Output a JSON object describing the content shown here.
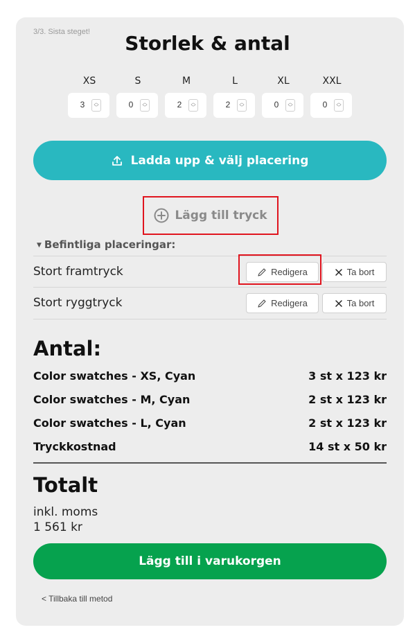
{
  "step": "3/3. Sista steget!",
  "title": "Storlek & antal",
  "sizes": [
    {
      "label": "XS",
      "value": "3"
    },
    {
      "label": "S",
      "value": "0"
    },
    {
      "label": "M",
      "value": "2"
    },
    {
      "label": "L",
      "value": "2"
    },
    {
      "label": "XL",
      "value": "0"
    },
    {
      "label": "XXL",
      "value": "0"
    }
  ],
  "upload_button": "Ladda upp & välj placering",
  "add_print_button": "Lägg till tryck",
  "existing_heading": "Befintliga placeringar:",
  "placements": [
    {
      "label": "Stort framtryck",
      "edit": "Redigera",
      "remove": "Ta bort"
    },
    {
      "label": "Stort ryggtryck",
      "edit": "Redigera",
      "remove": "Ta bort"
    }
  ],
  "antal_title": "Antal:",
  "line_items": [
    {
      "label": "Color swatches - XS, Cyan",
      "value": "3 st x 123 kr"
    },
    {
      "label": "Color swatches - M, Cyan",
      "value": "2 st x 123 kr"
    },
    {
      "label": "Color swatches - L, Cyan",
      "value": "2 st x 123 kr"
    },
    {
      "label": "Tryckkostnad",
      "value": "14 st x 50 kr"
    }
  ],
  "total_title": "Totalt",
  "incl_vat": "inkl. moms",
  "total_amount": "1 561 kr",
  "cart_button": "Lägg till i varukorgen",
  "back_link": "< Tillbaka till metod",
  "colors": {
    "upload": "#29b8c0",
    "cart": "#06a24e",
    "highlight": "#e0141e",
    "card": "#ededed"
  }
}
